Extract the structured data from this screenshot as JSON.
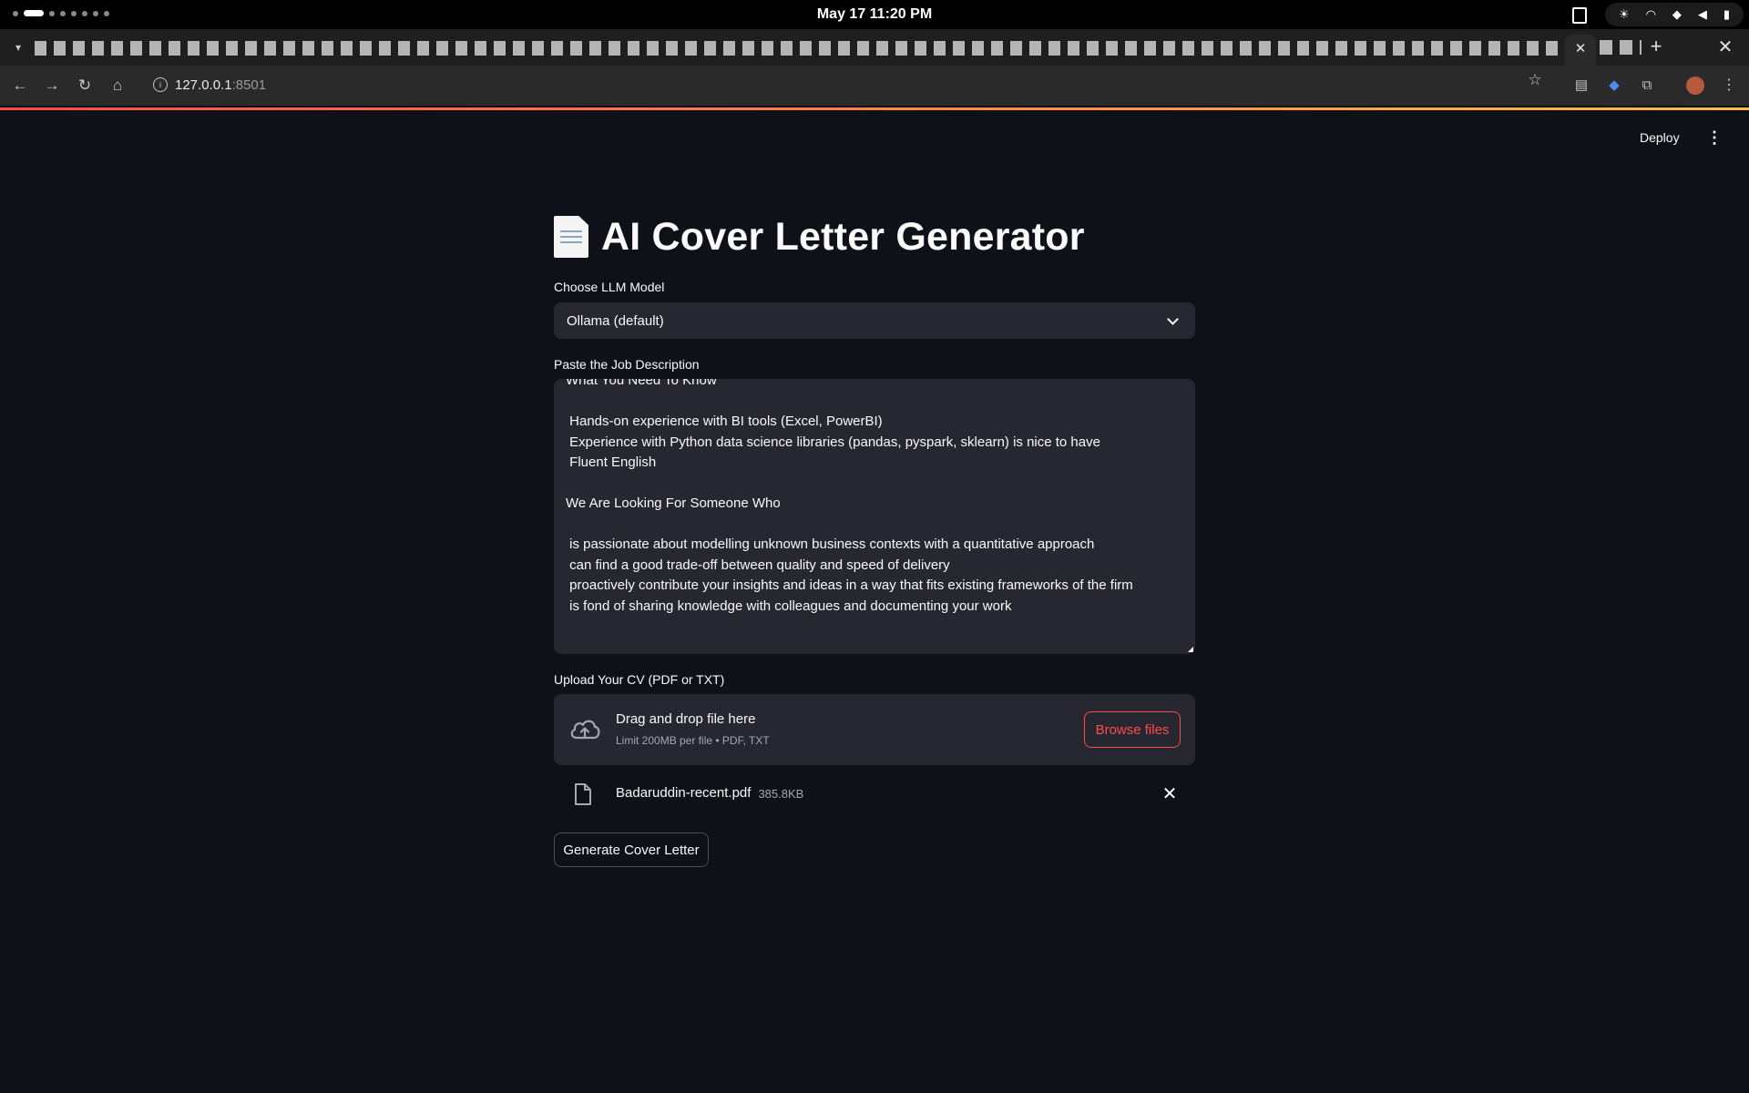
{
  "system": {
    "clock": "May 17  11:20 PM"
  },
  "browser": {
    "active_tab_close": "✕",
    "new_tab": "+",
    "window_close": "✕",
    "url_host": "127.0.0.1",
    "url_port": ":8501"
  },
  "app": {
    "header": {
      "deploy_label": "Deploy"
    },
    "title": "AI Cover Letter Generator",
    "model_select": {
      "label": "Choose LLM Model",
      "value": "Ollama (default)"
    },
    "job_description": {
      "label": "Paste the Job Description",
      "lines": [
        "What You Need To Know",
        "",
        " Hands-on experience with BI tools (Excel, PowerBI)",
        " Experience with Python data science libraries (pandas, pyspark, sklearn) is nice to have",
        " Fluent English",
        "",
        "We Are Looking For Someone Who",
        "",
        " is passionate about modelling unknown business contexts with a quantitative approach",
        " can find a good trade-off between quality and speed of delivery",
        " proactively contribute your insights and ideas in a way that fits existing frameworks of the firm",
        " is fond of sharing knowledge with colleagues and documenting your work"
      ]
    },
    "cv_upload": {
      "label": "Upload Your CV (PDF or TXT)",
      "drop_title": "Drag and drop file here",
      "drop_hint": "Limit 200MB per file • PDF, TXT",
      "browse_label": "Browse files",
      "file": {
        "name": "Badaruddin-recent.pdf",
        "size": "385.8KB"
      }
    },
    "generate_label": "Generate Cover Letter"
  },
  "colors": {
    "background": "#0e1117",
    "widget": "#262730",
    "accent": "#ff4b4b",
    "text": "#fafafa",
    "muted": "#a3a8b4"
  }
}
